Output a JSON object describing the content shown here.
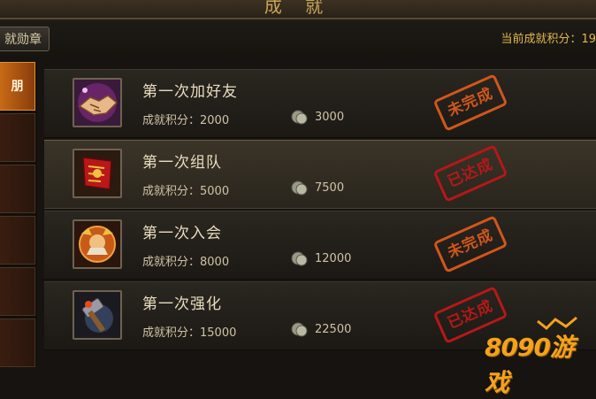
{
  "header": {
    "title": "成 就"
  },
  "toolbar": {
    "tab_label": "就勋章",
    "points_label": "当前成就积分：19"
  },
  "sidebar": {
    "items": [
      {
        "label": "朋",
        "active": true
      },
      {
        "label": ""
      },
      {
        "label": ""
      },
      {
        "label": ""
      },
      {
        "label": ""
      },
      {
        "label": ""
      }
    ]
  },
  "achievements": [
    {
      "name": "第一次加好友",
      "score": "成就积分：2000",
      "coins": "3000",
      "status": "未完成",
      "icon": "handshake-icon"
    },
    {
      "name": "第一次组队",
      "score": "成就积分：5000",
      "coins": "7500",
      "status": "已达成",
      "icon": "banner-icon"
    },
    {
      "name": "第一次入会",
      "score": "成就积分：8000",
      "coins": "12000",
      "status": "未完成",
      "icon": "guild-emblem-icon"
    },
    {
      "name": "第一次强化",
      "score": "成就积分：15000",
      "coins": "22500",
      "status": "已达成",
      "icon": "forge-hammer-icon"
    }
  ],
  "watermark": {
    "text": "8090游戏"
  },
  "colors": {
    "accent": "#e2b94a",
    "stamp_incomplete": "#d2561a",
    "stamp_complete": "#b51818"
  }
}
